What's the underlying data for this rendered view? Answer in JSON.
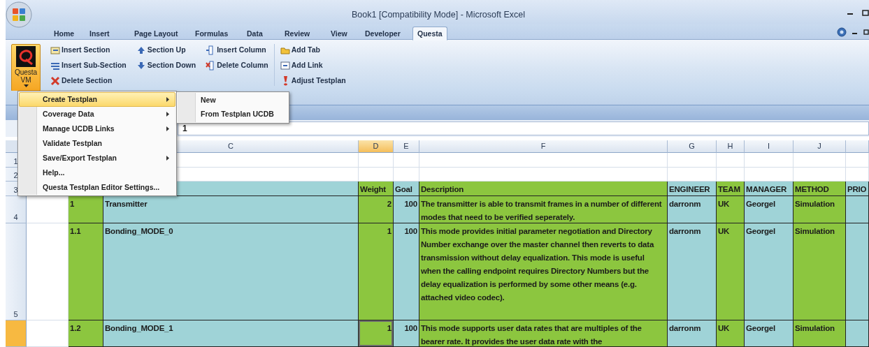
{
  "window": {
    "title": "Book1  [Compatibility Mode] - Microsoft Excel"
  },
  "ribbon_tabs": [
    {
      "label": "Home",
      "selected": false
    },
    {
      "label": "Insert",
      "selected": false
    },
    {
      "label": "Page Layout",
      "selected": false
    },
    {
      "label": "Formulas",
      "selected": false
    },
    {
      "label": "Data",
      "selected": false
    },
    {
      "label": "Review",
      "selected": false
    },
    {
      "label": "View",
      "selected": false
    },
    {
      "label": "Developer",
      "selected": false
    },
    {
      "label": "Questa",
      "selected": true
    }
  ],
  "ribbon": {
    "main_button": {
      "lines": [
        "Questa",
        "VM"
      ]
    },
    "command_columns": [
      [
        "Insert Section",
        "Insert Sub-Section",
        "Delete Section"
      ],
      [
        "Section Up",
        "Section Down"
      ],
      [
        "Insert Column",
        "Delete Column"
      ],
      [
        "Add Tab",
        "Add Link",
        "Adjust Testplan"
      ]
    ]
  },
  "formula_bar": {
    "value": "1"
  },
  "sheet": {
    "columns": [
      {},
      {},
      {
        "letter": "C",
        "selected": false
      },
      {
        "letter": "D",
        "selected": true
      },
      {
        "letter": "E",
        "selected": false
      },
      {
        "letter": "F",
        "selected": false
      },
      {
        "letter": "G",
        "selected": false
      },
      {
        "letter": "H",
        "selected": false
      },
      {
        "letter": "I",
        "selected": false
      },
      {
        "letter": "J",
        "selected": false
      },
      {
        "selected": false
      }
    ],
    "rows": [
      {
        "number": "1",
        "selected": false,
        "cells": [
          {},
          {},
          {
            "selected": false
          },
          {
            "selected": false
          },
          {
            "selected": false
          },
          {
            "selected": false
          },
          {
            "selected": false
          },
          {
            "selected": false
          },
          {
            "selected": false
          },
          {
            "selected": false
          },
          {
            "selected": false
          }
        ]
      },
      {
        "number": "2",
        "selected": false,
        "cells": [
          {},
          {},
          {
            "selected": false
          },
          {
            "selected": false
          },
          {
            "selected": false
          },
          {
            "selected": false
          },
          {
            "selected": false
          },
          {
            "selected": false
          },
          {
            "selected": false
          },
          {
            "selected": false
          },
          {
            "selected": false
          }
        ]
      },
      {
        "number": "3",
        "selected": false,
        "cells": [
          {},
          {},
          {
            "selected": false,
            "color": "#9fd3d7"
          },
          {
            "text": "Weight",
            "kind": "text",
            "selected": false,
            "color": "#8cc63f"
          },
          {
            "text": "Goal",
            "kind": "text",
            "selected": false,
            "color": "#9fd3d7"
          },
          {
            "text": "Description",
            "kind": "text",
            "selected": false,
            "color": "#8cc63f"
          },
          {
            "text": "ENGINEER",
            "kind": "text",
            "selected": false,
            "color": "#9fd3d7"
          },
          {
            "text": "TEAM",
            "kind": "text",
            "selected": false,
            "color": "#8cc63f"
          },
          {
            "text": "MANAGER",
            "kind": "text",
            "selected": false,
            "color": "#9fd3d7"
          },
          {
            "text": "METHOD",
            "kind": "text",
            "selected": false,
            "color": "#8cc63f"
          },
          {
            "text": "PRIO",
            "kind": "text",
            "selected": false,
            "color": "#9fd3d7"
          }
        ]
      },
      {
        "number": "4",
        "selected": false,
        "cells": [
          {
            "selected": false
          },
          {
            "text": "1",
            "kind": "text",
            "selected": false,
            "color": "#8cc63f"
          },
          {
            "text": "Transmitter",
            "kind": "text",
            "selected": false,
            "color": "#9fd3d7"
          },
          {
            "text": "2",
            "kind": "number",
            "selected": false,
            "color": "#8cc63f"
          },
          {
            "text": "100",
            "kind": "number",
            "selected": false,
            "color": "#9fd3d7"
          },
          {
            "text": "The transmitter is able to transmit frames in a number of different modes that need to be verified seperately.",
            "kind": "text",
            "selected": false,
            "color": "#8cc63f"
          },
          {
            "text": "darronm",
            "kind": "text",
            "selected": false,
            "color": "#9fd3d7"
          },
          {
            "text": "UK",
            "kind": "text",
            "selected": false,
            "color": "#8cc63f"
          },
          {
            "text": "Georgel",
            "kind": "text",
            "selected": false,
            "color": "#9fd3d7"
          },
          {
            "text": "Simulation",
            "kind": "text",
            "selected": false,
            "color": "#8cc63f"
          },
          {
            "selected": false,
            "color": "#9fd3d7"
          }
        ]
      },
      {
        "number": "5",
        "selected": false,
        "cells": [
          {
            "selected": false
          },
          {
            "text": "1.1",
            "kind": "text",
            "selected": false,
            "color": "#8cc63f"
          },
          {
            "text": "Bonding_MODE_0",
            "kind": "text",
            "selected": false,
            "color": "#9fd3d7"
          },
          {
            "text": "1",
            "kind": "number",
            "selected": false,
            "color": "#8cc63f"
          },
          {
            "text": "100",
            "kind": "number",
            "selected": false,
            "color": "#9fd3d7"
          },
          {
            "text": "This mode provides initial parameter negotiation and Directory Number exchange over the master channel then reverts to data transmission without delay equalization. This mode is useful when the calling endpoint requires Directory Numbers but the delay equalization is performed by some other means (e.g. attached video codec).",
            "kind": "text",
            "selected": false,
            "color": "#8cc63f"
          },
          {
            "text": "darronm",
            "kind": "text",
            "selected": false,
            "color": "#9fd3d7"
          },
          {
            "text": "UK",
            "kind": "text",
            "selected": false,
            "color": "#8cc63f"
          },
          {
            "text": "Georgel",
            "kind": "text",
            "selected": false,
            "color": "#9fd3d7"
          },
          {
            "text": "Simulation",
            "kind": "text",
            "selected": false,
            "color": "#8cc63f"
          },
          {
            "selected": false,
            "color": "#9fd3d7"
          }
        ]
      },
      {
        "selected": true,
        "cells": [
          {
            "selected": false
          },
          {
            "text": "1.2",
            "kind": "text",
            "selected": false,
            "color": "#8cc63f"
          },
          {
            "text": "Bonding_MODE_1",
            "kind": "text",
            "selected": false,
            "color": "#9fd3d7"
          },
          {
            "text": "1",
            "kind": "number",
            "selected": true,
            "color": "#8cc63f"
          },
          {
            "text": "100",
            "kind": "number",
            "selected": false,
            "color": "#9fd3d7"
          },
          {
            "text": "This mode supports user data rates that are multiples of the bearer rate. It provides the user data rate with the",
            "kind": "text",
            "selected": false,
            "color": "#8cc63f"
          },
          {
            "text": "darronm",
            "kind": "text",
            "selected": false,
            "color": "#9fd3d7"
          },
          {
            "text": "UK",
            "kind": "text",
            "selected": false,
            "color": "#8cc63f"
          },
          {
            "text": "Georgel",
            "kind": "text",
            "selected": false,
            "color": "#9fd3d7"
          },
          {
            "text": "Simulation",
            "kind": "text",
            "selected": false,
            "color": "#8cc63f"
          },
          {
            "selected": false,
            "color": "#9fd3d7"
          }
        ]
      }
    ]
  },
  "menu": {
    "items": [
      {
        "label": "Create Testplan",
        "has_submenu": true,
        "selected": true
      },
      {
        "label": "Coverage Data",
        "has_submenu": true,
        "selected": false
      },
      {
        "label": "Manage UCDB Links",
        "has_submenu": true,
        "selected": false
      },
      {
        "label": "Validate Testplan",
        "has_submenu": false,
        "selected": false
      },
      {
        "label": "Save/Export Testplan",
        "has_submenu": true,
        "selected": false
      },
      {
        "label": "Help...",
        "has_submenu": false,
        "selected": false
      },
      {
        "label": "Questa Testplan Editor Settings...",
        "has_submenu": false,
        "selected": false
      }
    ]
  },
  "submenu": {
    "items": [
      {
        "label": "New",
        "selected": false
      },
      {
        "label": "From Testplan UCDB",
        "selected": false
      }
    ]
  }
}
